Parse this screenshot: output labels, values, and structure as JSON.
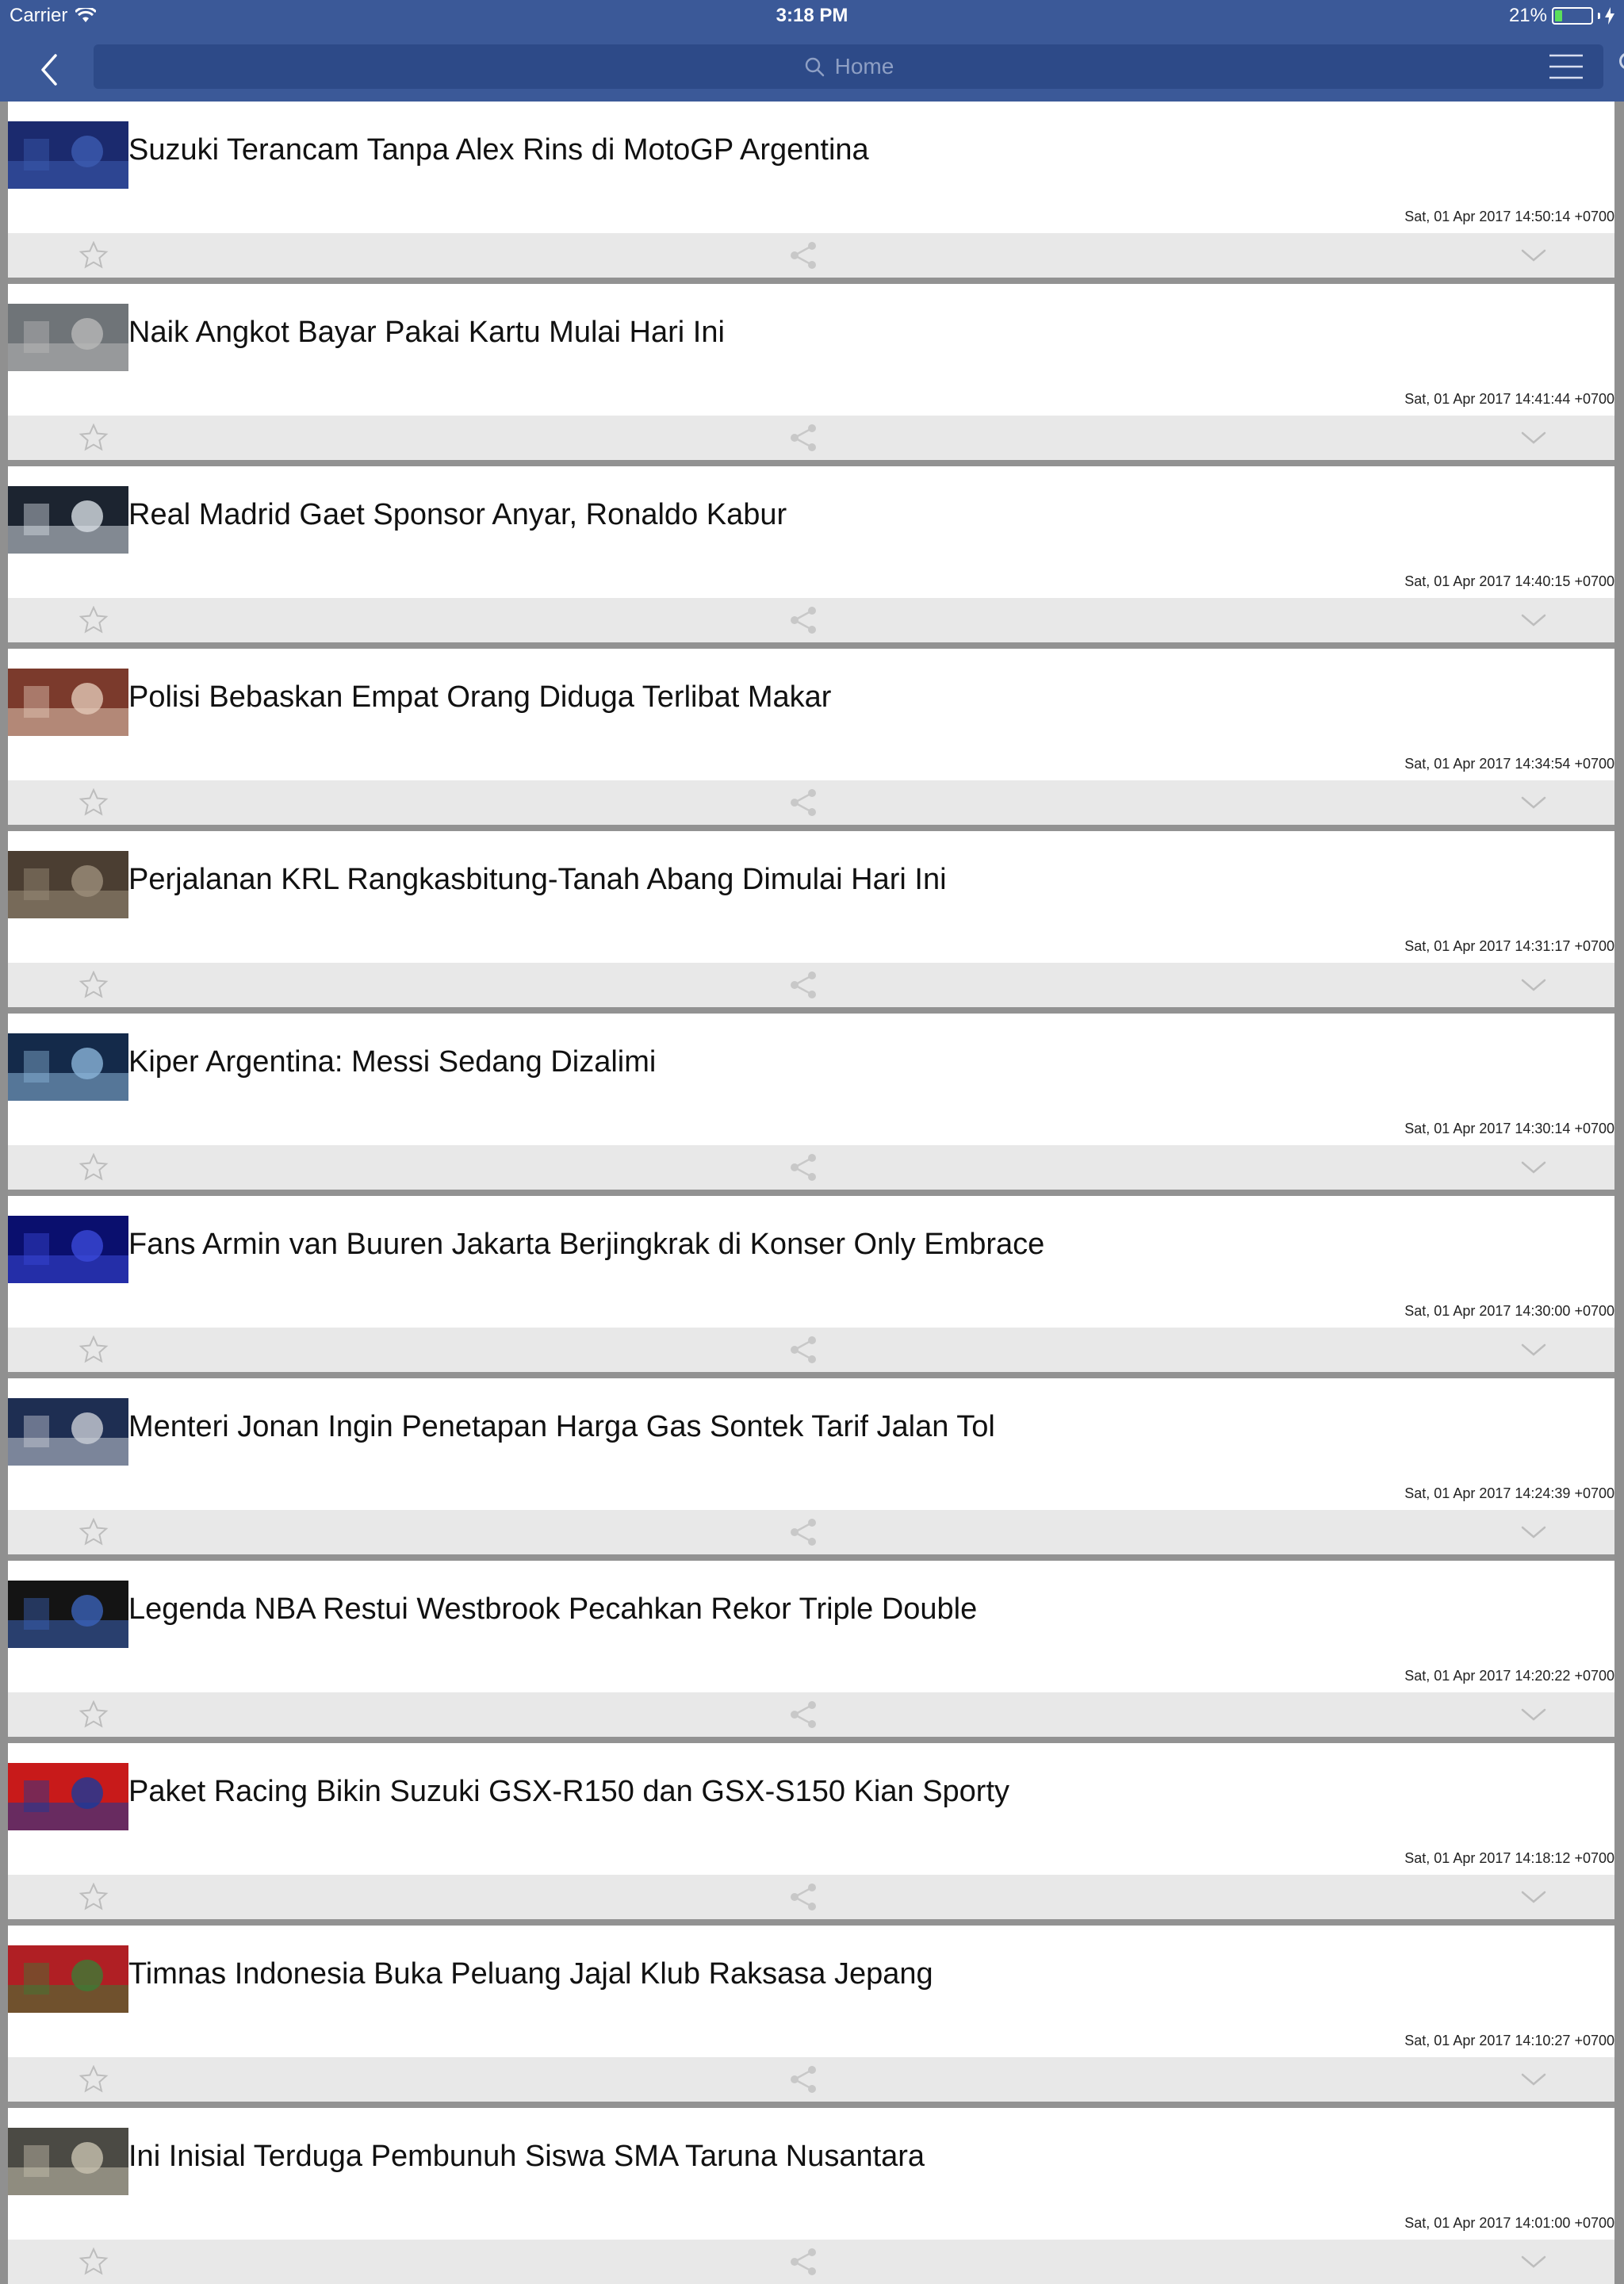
{
  "status": {
    "carrier": "Carrier",
    "time": "3:18 PM",
    "battery": "21%",
    "battery_level": 0.21
  },
  "nav": {
    "search_placeholder": "Home"
  },
  "colors": {
    "nav_bg": "#3b5998",
    "search_bg": "#2d4a88",
    "action_bar": "#e8e8e8"
  },
  "articles": [
    {
      "title": "Suzuki Terancam Tanpa Alex Rins di MotoGP Argentina",
      "date": "Sat, 01 Apr 2017 14:50:14 +0700",
      "thumb": [
        "#1b2a6e",
        "#3c5bb0"
      ]
    },
    {
      "title": "Naik Angkot Bayar Pakai Kartu Mulai Hari Ini",
      "date": "Sat, 01 Apr 2017 14:41:44 +0700",
      "thumb": [
        "#6f7478",
        "#b8b8b8"
      ]
    },
    {
      "title": "Real Madrid Gaet Sponsor Anyar, Ronaldo Kabur",
      "date": "Sat, 01 Apr 2017 14:40:15 +0700",
      "thumb": [
        "#1c2430",
        "#d7dde4"
      ]
    },
    {
      "title": "Polisi Bebaskan Empat Orang Diduga Terlibat Makar",
      "date": "Sat, 01 Apr 2017 14:34:54 +0700",
      "thumb": [
        "#7b3a2c",
        "#e2c8b6"
      ]
    },
    {
      "title": "Perjalanan KRL Rangkasbitung-Tanah Abang Dimulai Hari Ini",
      "date": "Sat, 01 Apr 2017 14:31:17 +0700",
      "thumb": [
        "#4b3e32",
        "#9c8e7a"
      ]
    },
    {
      "title": "Kiper Argentina: Messi Sedang Dizalimi",
      "date": "Sat, 01 Apr 2017 14:30:14 +0700",
      "thumb": [
        "#142a4a",
        "#8ab4d8"
      ]
    },
    {
      "title": "Fans Armin van Buuren Jakarta Berjingkrak di Konser Only Embrace",
      "date": "Sat, 01 Apr 2017 14:30:00 +0700",
      "thumb": [
        "#0a0f6e",
        "#3a48d8"
      ]
    },
    {
      "title": "Menteri Jonan Ingin Penetapan Harga Gas Sontek Tarif Jalan Tol",
      "date": "Sat, 01 Apr 2017 14:24:39 +0700",
      "thumb": [
        "#1e2e52",
        "#c9cdd6"
      ]
    },
    {
      "title": "Legenda NBA Restui Westbrook Pecahkan Rekor Triple Double",
      "date": "Sat, 01 Apr 2017 14:20:22 +0700",
      "thumb": [
        "#141414",
        "#3a62b8"
      ]
    },
    {
      "title": "Paket Racing Bikin Suzuki GSX-R150 dan GSX-S150 Kian Sporty",
      "date": "Sat, 01 Apr 2017 14:18:12 +0700",
      "thumb": [
        "#c81a1a",
        "#1a3a9a"
      ]
    },
    {
      "title": "Timnas Indonesia Buka Peluang Jajal Klub Raksasa Jepang",
      "date": "Sat, 01 Apr 2017 14:10:27 +0700",
      "thumb": [
        "#b01f24",
        "#3d7a35"
      ]
    },
    {
      "title": "Ini Inisial Terduga Pembunuh Siswa SMA Taruna Nusantara",
      "date": "Sat, 01 Apr 2017 14:01:00 +0700",
      "thumb": [
        "#4b4a44",
        "#c8c2b0"
      ]
    }
  ]
}
